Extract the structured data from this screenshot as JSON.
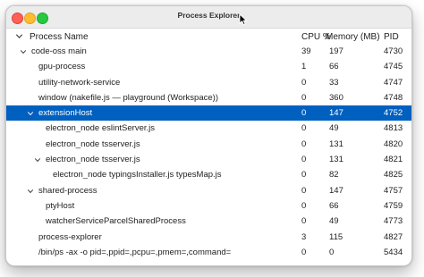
{
  "window": {
    "title": "Process Explorer"
  },
  "header": {
    "name": "Process Name",
    "cpu": "CPU %",
    "memory": "Memory (MB)",
    "pid": "PID"
  },
  "rows": [
    {
      "name": "code-oss main",
      "cpu": "39",
      "memory": "197",
      "pid": "4730",
      "depth": 0,
      "twistie": "chevron-down-icon"
    },
    {
      "name": "gpu-process",
      "cpu": "1",
      "memory": "66",
      "pid": "4745",
      "depth": 1,
      "twistie": ""
    },
    {
      "name": "utility-network-service",
      "cpu": "0",
      "memory": "33",
      "pid": "4747",
      "depth": 1,
      "twistie": ""
    },
    {
      "name": "window (nakefile.js — playground (Workspace))",
      "cpu": "0",
      "memory": "360",
      "pid": "4748",
      "depth": 1,
      "twistie": ""
    },
    {
      "name": "extensionHost",
      "cpu": "0",
      "memory": "147",
      "pid": "4752",
      "depth": 1,
      "twistie": "chevron-down-icon",
      "selected": true
    },
    {
      "name": "electron_node eslintServer.js",
      "cpu": "0",
      "memory": "49",
      "pid": "4813",
      "depth": 2,
      "twistie": ""
    },
    {
      "name": "electron_node tsserver.js",
      "cpu": "0",
      "memory": "131",
      "pid": "4820",
      "depth": 2,
      "twistie": ""
    },
    {
      "name": "electron_node tsserver.js",
      "cpu": "0",
      "memory": "131",
      "pid": "4821",
      "depth": 2,
      "twistie": "chevron-down-icon"
    },
    {
      "name": "electron_node typingsInstaller.js typesMap.js",
      "cpu": "0",
      "memory": "82",
      "pid": "4825",
      "depth": 3,
      "twistie": ""
    },
    {
      "name": "shared-process",
      "cpu": "0",
      "memory": "147",
      "pid": "4757",
      "depth": 1,
      "twistie": "chevron-down-icon"
    },
    {
      "name": "ptyHost",
      "cpu": "0",
      "memory": "66",
      "pid": "4759",
      "depth": 2,
      "twistie": ""
    },
    {
      "name": "watcherServiceParcelSharedProcess",
      "cpu": "0",
      "memory": "49",
      "pid": "4773",
      "depth": 2,
      "twistie": ""
    },
    {
      "name": "process-explorer",
      "cpu": "3",
      "memory": "115",
      "pid": "4827",
      "depth": 1,
      "twistie": ""
    },
    {
      "name": "/bin/ps -ax -o pid=,ppid=,pcpu=,pmem=,command=",
      "cpu": "0",
      "memory": "0",
      "pid": "5434",
      "depth": 1,
      "twistie": ""
    }
  ],
  "colors": {
    "selection": "#0060c0",
    "close": "#fe5f57",
    "minimize": "#febc2e",
    "maximize": "#28c840"
  }
}
